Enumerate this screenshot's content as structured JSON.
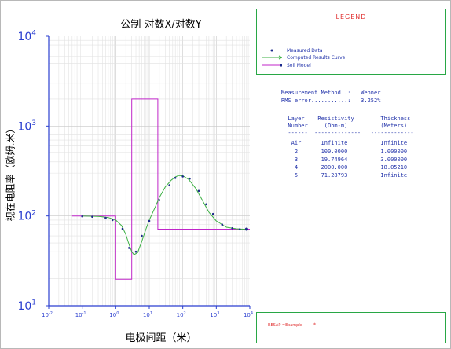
{
  "chart_data": {
    "type": "line",
    "title": "公制 对数X/对数Y",
    "xlabel": "电极间距（米）",
    "ylabel": "视在电阻率（欧姆.米）",
    "x_scale": "log",
    "y_scale": "log",
    "xlim": [
      0.01,
      10000
    ],
    "ylim": [
      10,
      10000
    ],
    "grid": true,
    "x_ticks": [
      {
        "base": "10",
        "exp": "-2"
      },
      {
        "base": "10",
        "exp": "-1"
      },
      {
        "base": "10",
        "exp": "0"
      },
      {
        "base": "10",
        "exp": "1"
      },
      {
        "base": "10",
        "exp": "2"
      },
      {
        "base": "10",
        "exp": "3"
      },
      {
        "base": "10",
        "exp": "4"
      }
    ],
    "y_ticks": [
      {
        "base": "10",
        "exp": "1"
      },
      {
        "base": "10",
        "exp": "2"
      },
      {
        "base": "10",
        "exp": "3"
      },
      {
        "base": "10",
        "exp": "4"
      }
    ],
    "series": [
      {
        "name": "Measured Data",
        "marker": "dot",
        "color": "#1c2a8c",
        "points": [
          [
            0.1,
            99
          ],
          [
            0.2,
            98
          ],
          [
            0.5,
            95
          ],
          [
            0.8,
            90
          ],
          [
            1.6,
            72
          ],
          [
            2.5,
            44
          ],
          [
            4,
            40
          ],
          [
            6,
            60
          ],
          [
            10,
            88
          ],
          [
            20,
            150
          ],
          [
            40,
            220
          ],
          [
            60,
            265
          ],
          [
            100,
            275
          ],
          [
            160,
            260
          ],
          [
            300,
            190
          ],
          [
            500,
            135
          ],
          [
            800,
            105
          ],
          [
            1500,
            80
          ],
          [
            3000,
            73
          ],
          [
            5000,
            71
          ],
          [
            8000,
            71
          ]
        ]
      },
      {
        "name": "Computed Results Curve",
        "color": "#3cb043",
        "points": [
          [
            0.1,
            100
          ],
          [
            0.3,
            99
          ],
          [
            0.6,
            96
          ],
          [
            1,
            90
          ],
          [
            1.5,
            78
          ],
          [
            2,
            62
          ],
          [
            2.5,
            48
          ],
          [
            3,
            40
          ],
          [
            3.5,
            37
          ],
          [
            4.5,
            39
          ],
          [
            6,
            52
          ],
          [
            8,
            72
          ],
          [
            10,
            90
          ],
          [
            15,
            125
          ],
          [
            20,
            160
          ],
          [
            30,
            210
          ],
          [
            45,
            250
          ],
          [
            60,
            272
          ],
          [
            75,
            282
          ],
          [
            100,
            280
          ],
          [
            150,
            255
          ],
          [
            250,
            200
          ],
          [
            400,
            145
          ],
          [
            600,
            110
          ],
          [
            1000,
            88
          ],
          [
            2000,
            75
          ],
          [
            4000,
            72
          ],
          [
            8000,
            71
          ]
        ]
      },
      {
        "name": "Soil Model",
        "color": "#c026c9",
        "points": [
          [
            0.05,
            100
          ],
          [
            1,
            100
          ],
          [
            1,
            19.75
          ],
          [
            3,
            19.75
          ],
          [
            3,
            2000
          ],
          [
            18.05,
            2000
          ],
          [
            18.05,
            71.29
          ],
          [
            10000,
            71.29
          ]
        ]
      }
    ]
  },
  "legend": {
    "title": "LEGEND",
    "items": [
      {
        "label": "Measured Data",
        "color": "#1c2a8c"
      },
      {
        "label": "Computed Results Curve",
        "color": "#3cb043"
      },
      {
        "label": "Soil Model",
        "color": "#c026c9"
      }
    ]
  },
  "results": {
    "method_line": "Measurement Method..:   Wenner",
    "rms_line": "RMS error...........:   3.252%",
    "header_line1": "  Layer    Resistivity        Thickness",
    "header_line2": "  Number     (Ohm-m)          (Meters)",
    "header_line3": "  ------  --------------   -------------",
    "rows": [
      "   Air      Infinite          Infinite",
      "    2       100.0000          1.000000",
      "    3       19.74964          3.000000",
      "    4       2000.000          18.05210",
      "    5       71.28793          Infinite"
    ]
  },
  "footer": {
    "label": "RESAP =Example",
    "marker": "*"
  }
}
